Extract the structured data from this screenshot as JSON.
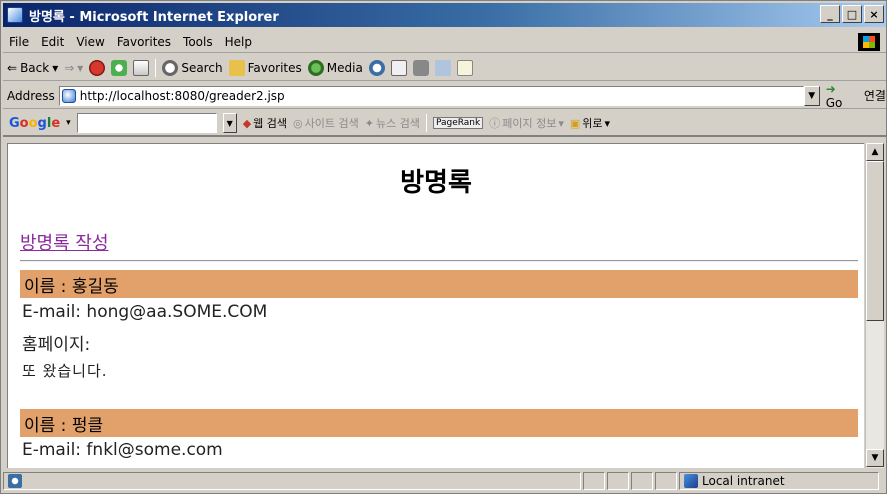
{
  "window": {
    "title": "방명록 - Microsoft Internet Explorer"
  },
  "title_controls": {
    "minimize": "_",
    "maximize": "□",
    "close": "×"
  },
  "menu": [
    "File",
    "Edit",
    "View",
    "Favorites",
    "Tools",
    "Help"
  ],
  "toolbar": {
    "back": "Back",
    "search": "Search",
    "favorites": "Favorites",
    "media": "Media"
  },
  "address": {
    "label": "Address",
    "url": "http://localhost:8080/greader2.jsp",
    "go": "Go",
    "links": "연결"
  },
  "google_toolbar": {
    "logo": "Google",
    "web_search": "웹 검색",
    "site_search": "사이트 검색",
    "news_search": "뉴스 검색",
    "pagerank": "PageRank",
    "page_info": "페이지 정보",
    "up": "위로"
  },
  "page": {
    "title": "방명록",
    "write_link": "방명록 작성",
    "entries": [
      {
        "name": "이름 : 홍길동",
        "email": "E-mail: hong@aa.SOME.COM",
        "homepage": "홈페이지:",
        "message": "또 왔습니다."
      },
      {
        "name": "이름 : 펑클",
        "email": "E-mail: fnkl@some.com"
      }
    ]
  },
  "status": {
    "zone": "Local intranet"
  }
}
